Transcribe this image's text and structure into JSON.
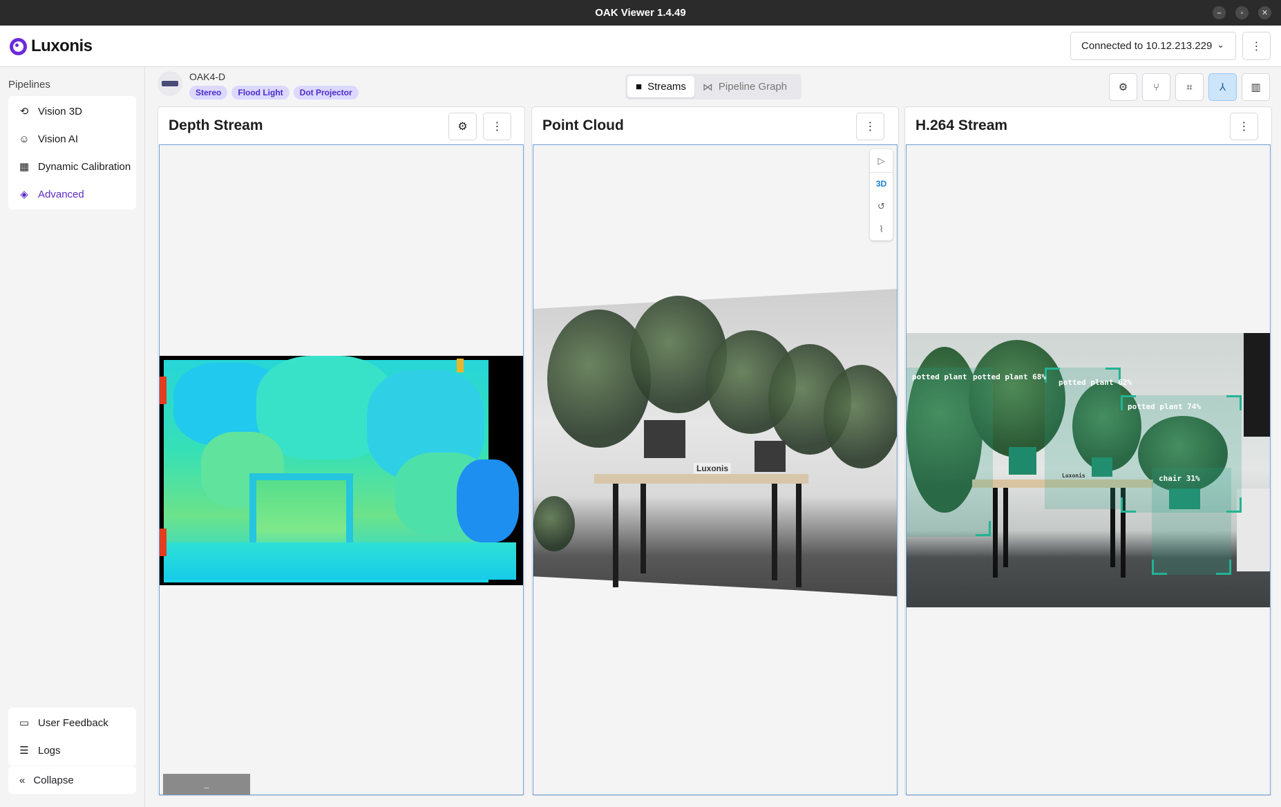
{
  "window": {
    "title": "OAK Viewer 1.4.49"
  },
  "header": {
    "brand": "Luxonis",
    "connection": "Connected to 10.12.213.229"
  },
  "sidebar": {
    "title": "Pipelines",
    "items": [
      {
        "label": "Vision 3D",
        "icon": "3d-rotate-icon"
      },
      {
        "label": "Vision AI",
        "icon": "face-scan-icon"
      },
      {
        "label": "Dynamic Calibration",
        "icon": "checkerboard-icon"
      },
      {
        "label": "Advanced",
        "icon": "layers-icon",
        "active": true
      }
    ],
    "bottom_items": [
      {
        "label": "User Feedback",
        "icon": "feedback-icon"
      },
      {
        "label": "Logs",
        "icon": "logs-icon"
      }
    ],
    "collapse_label": "Collapse"
  },
  "device": {
    "name": "OAK4-D",
    "features": [
      "Stereo",
      "Flood Light",
      "Dot Projector"
    ]
  },
  "view_tabs": [
    {
      "label": "Streams",
      "icon": "camera-icon",
      "active": true
    },
    {
      "label": "Pipeline Graph",
      "icon": "graph-icon",
      "active": false
    }
  ],
  "panels": {
    "depth": {
      "title": "Depth Stream",
      "button_label": "–"
    },
    "pointcloud": {
      "title": "Point Cloud",
      "mode_label": "3D",
      "logo_text": "Luxonis"
    },
    "h264": {
      "title": "H.264 Stream",
      "detections": [
        {
          "label": "potted plant 68%"
        },
        {
          "label": "potted plant 62%"
        },
        {
          "label": "potted plant 74%"
        },
        {
          "label": "chair 31%"
        }
      ],
      "overlap_label": "potted plant",
      "logo_text": "Luxonis"
    }
  },
  "colors": {
    "accent": "#6c2bd9",
    "chip_bg": "#dcd8ff",
    "chip_text": "#4b2cc7",
    "detection": "#24b393",
    "view_border": "#6a9dcf"
  }
}
